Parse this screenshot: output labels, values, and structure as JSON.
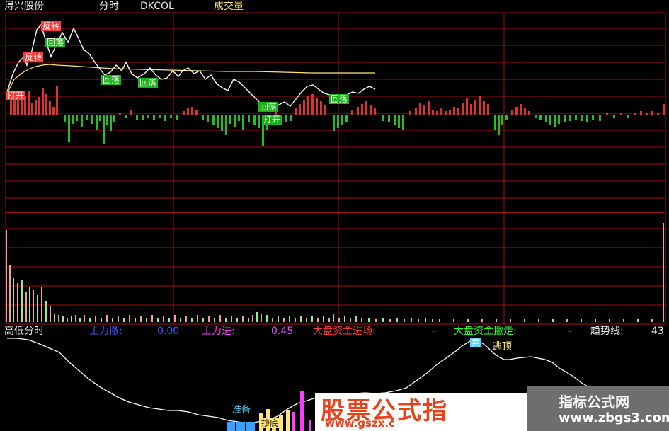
{
  "header": {
    "stock_name": "浔兴股份",
    "view_mode": "分时",
    "indicator": "DKCOL",
    "volume_label": "成交量"
  },
  "price_tags": {
    "buy": "打开",
    "reversal_top_1": "反转",
    "reversal_top_2": "反转",
    "pullback_1": "回落",
    "pullback_2": "回落",
    "pullback_3": "回落",
    "pullback_4": "回落",
    "pullback_5": "回落",
    "low_buy": "打开"
  },
  "lower_header": {
    "title": "高低分时",
    "main_sell_label": "主力撤:",
    "main_sell_value": "0.00",
    "main_in_label": "主力进:",
    "main_in_value": "0.45",
    "market_in_label": "大盘资金进场:",
    "market_in_value": "-",
    "market_out_label": "大盘资金撤走:",
    "market_out_value": "-",
    "trend_label": "趋势线:",
    "trend_value": "43"
  },
  "lower_tags": {
    "top_marker": "卖",
    "top_label": "逃顶",
    "prepare_label": "准备",
    "bottom_label": "抄底"
  },
  "watermark": {
    "site_title": "股票公式指",
    "site_url": "www.gszx.c",
    "brand_title": "指标公式网",
    "brand_url": "www.zbgs3.com"
  },
  "colors": {
    "background": "#000000",
    "grid": "#a01010",
    "price_line": "#ffffff",
    "avg_line": "#ffe27a",
    "up_bar": "#e03030",
    "down_bar": "#20c020",
    "header_text": "#e8e8e8",
    "main_sell": "#3b5bff",
    "main_in": "#ff3bff",
    "market_in": "#ff3b3b",
    "market_out": "#30ff30",
    "trend": "#ffffff"
  }
}
